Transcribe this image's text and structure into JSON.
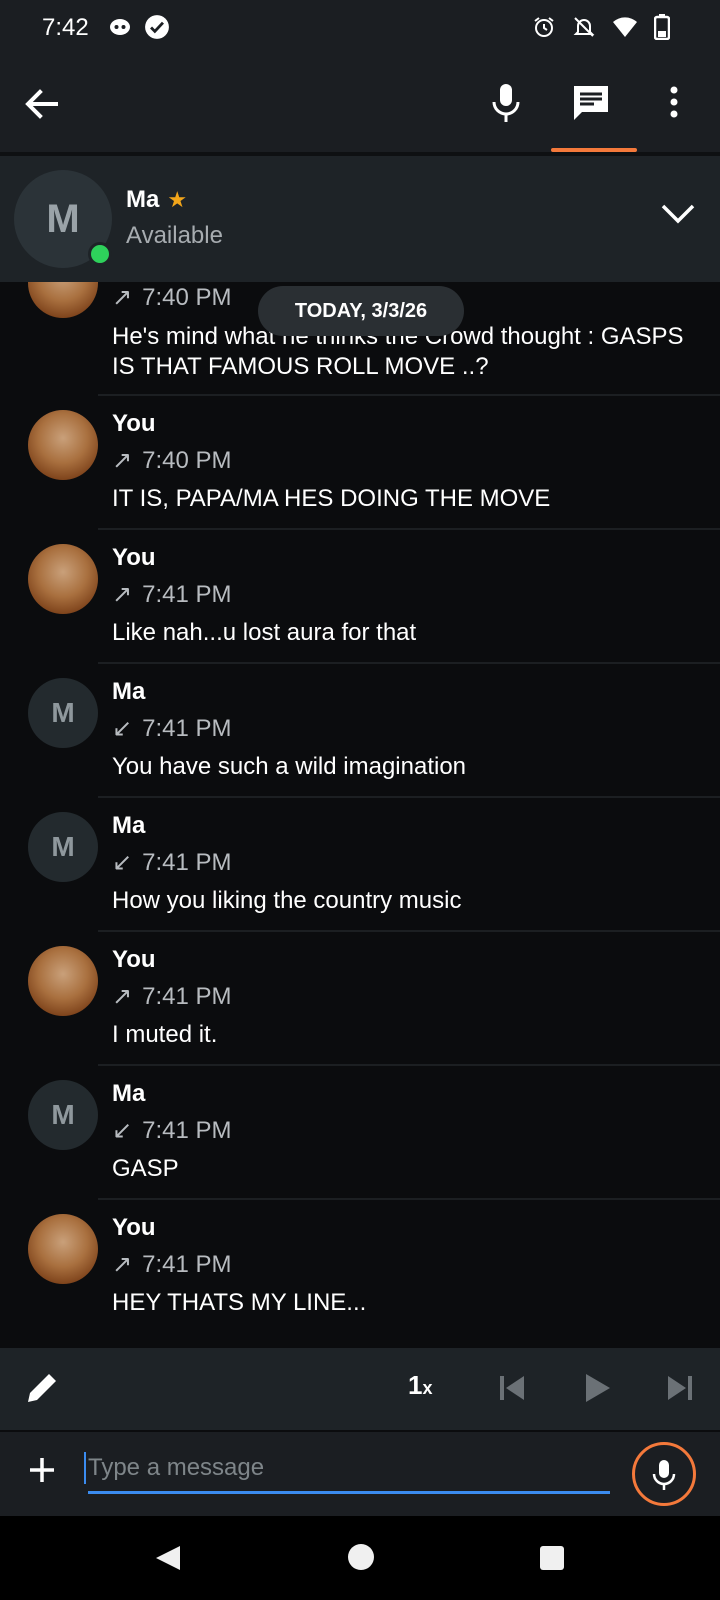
{
  "status_bar": {
    "time": "7:42"
  },
  "contact": {
    "initial": "M",
    "name": "Ma",
    "status": "Available"
  },
  "date_separator": "TODAY, 3/3/26",
  "messages": [
    {
      "sender": "",
      "time": "7:40 PM",
      "direction": "out",
      "avatar": "photo",
      "text": "He's mind what he thinks the Crowd thought : GASPS IS THAT FAMOUS ROLL MOVE ..?"
    },
    {
      "sender": "You",
      "time": "7:40 PM",
      "direction": "out",
      "avatar": "photo",
      "text": "IT IS, PAPA/MA HES DOING THE MOVE"
    },
    {
      "sender": "You",
      "time": "7:41 PM",
      "direction": "out",
      "avatar": "photo",
      "text": "Like nah...u lost aura for that"
    },
    {
      "sender": "Ma",
      "time": "7:41 PM",
      "direction": "in",
      "avatar": "M",
      "text": "You have such a wild imagination"
    },
    {
      "sender": "Ma",
      "time": "7:41 PM",
      "direction": "in",
      "avatar": "M",
      "text": "How you liking the country music"
    },
    {
      "sender": "You",
      "time": "7:41 PM",
      "direction": "out",
      "avatar": "photo",
      "text": "I muted it."
    },
    {
      "sender": "Ma",
      "time": "7:41 PM",
      "direction": "in",
      "avatar": "M",
      "text": "GASP"
    },
    {
      "sender": "You",
      "time": "7:41 PM",
      "direction": "out",
      "avatar": "photo",
      "text": "HEY THATS MY LINE..."
    }
  ],
  "playback": {
    "speed": "1",
    "speed_suffix": "x"
  },
  "composer": {
    "placeholder": "Type a message"
  },
  "colors": {
    "accent": "#f4793b",
    "online": "#2ed15b",
    "star": "#f2a51a",
    "input_underline": "#3b8cf0"
  },
  "icons": {
    "status": [
      "discord-icon",
      "check-circle-icon",
      "alarm-icon",
      "bell-off-icon",
      "wifi-icon",
      "battery-icon"
    ],
    "app_bar": [
      "back-arrow-icon",
      "mic-icon",
      "chat-icon",
      "more-vert-icon"
    ],
    "playback": [
      "pencil-icon",
      "skip-previous-icon",
      "play-icon",
      "skip-next-icon"
    ],
    "composer": [
      "plus-icon",
      "mic-icon"
    ]
  }
}
